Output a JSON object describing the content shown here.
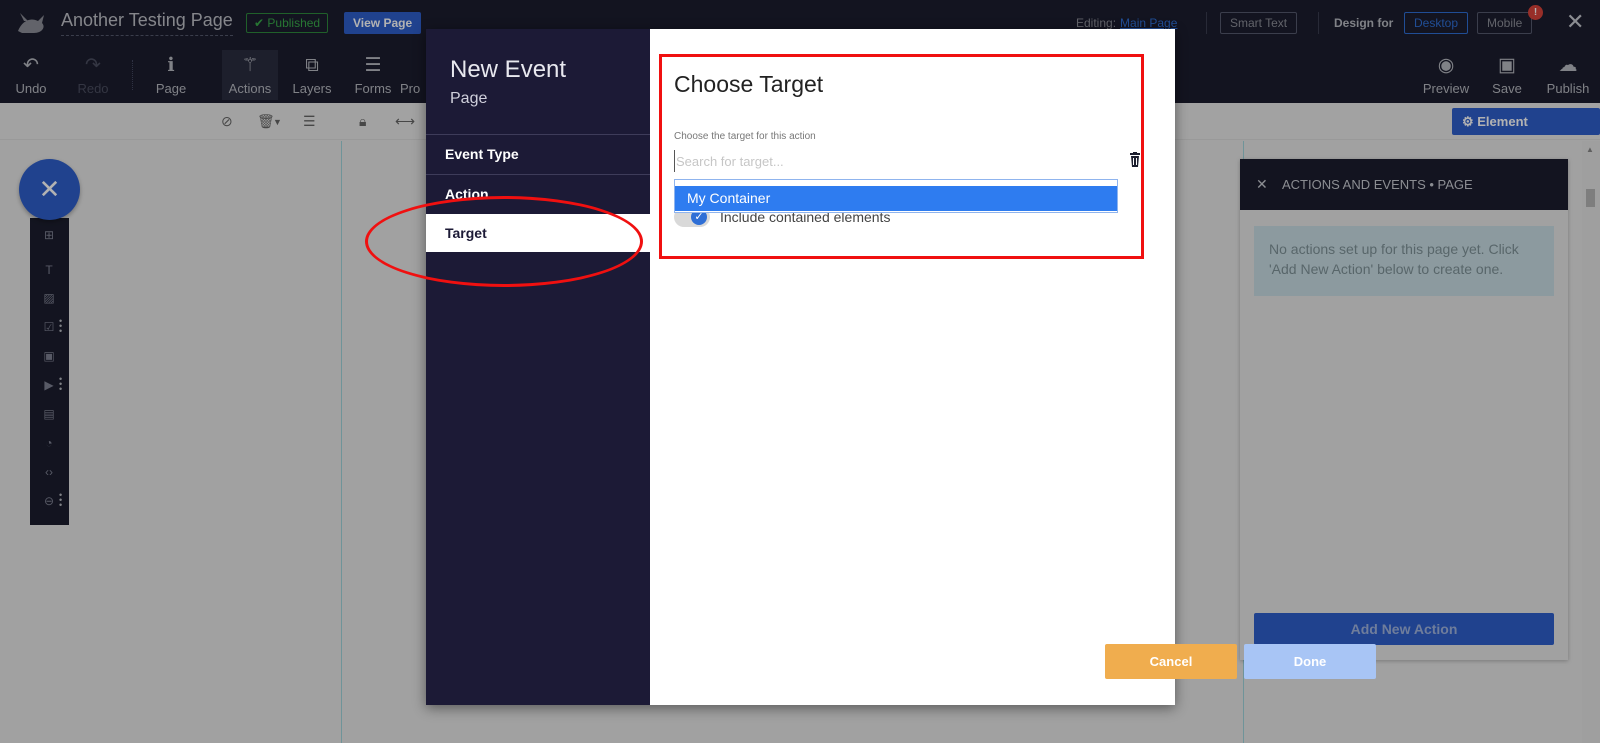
{
  "topbar": {
    "page_title": "Another Testing Page",
    "published_badge": "✔ Published",
    "view_page": "View Page",
    "editing_label": "Editing:",
    "editing_link": "Main Page",
    "smart_text": "Smart Text",
    "design_for": "Design for",
    "desktop": "Desktop",
    "mobile": "Mobile",
    "mobile_alert": "!",
    "close": "✕"
  },
  "toolbar": {
    "undo": "Undo",
    "redo": "Redo",
    "page": "Page",
    "actions": "Actions",
    "layers": "Layers",
    "forms": "Forms",
    "pro": "Pro",
    "preview": "Preview",
    "save": "Save",
    "publish": "Publish"
  },
  "subbar": {
    "element_properties": "⚙ Element Properties"
  },
  "left_panel": {
    "fab": "✕"
  },
  "actions_panel": {
    "title": "ACTIONS AND EVENTS • PAGE",
    "close": "✕",
    "message": "No actions set up for this page yet. Click 'Add New Action' below to create one.",
    "add_button": "Add New Action"
  },
  "modal": {
    "title": "New Event",
    "subtitle": "Page",
    "steps": [
      {
        "label": "Event Type"
      },
      {
        "label": "Action"
      },
      {
        "label": "Target"
      }
    ],
    "choose_title": "Choose Target",
    "field_label": "Choose the target for this action",
    "search_placeholder": "Search for target...",
    "dropdown_option": "My Container",
    "include_label": "Include contained elements",
    "cancel": "Cancel",
    "done": "Done"
  },
  "colors": {
    "dark_bg": "#1c1e2e",
    "modal_side": "#1c1a36",
    "primary": "#2f5fcc",
    "option_highlight": "#2e7cf0",
    "cancel": "#f0ad4e",
    "done_disabled": "#a8c5f5",
    "annotation_red": "#f01010"
  }
}
